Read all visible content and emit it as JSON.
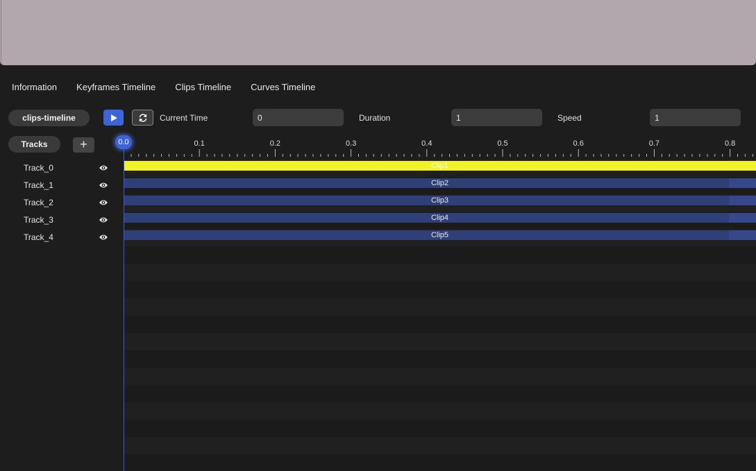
{
  "tabs": [
    "Information",
    "Keyframes Timeline",
    "Clips Timeline",
    "Curves Timeline"
  ],
  "controls": {
    "timeline_name": "clips-timeline",
    "current_time_label": "Current Time",
    "current_time_value": "0",
    "duration_label": "Duration",
    "duration_value": "1",
    "speed_label": "Speed",
    "speed_value": "1"
  },
  "tracks_header": {
    "label": "Tracks",
    "add_label": "+"
  },
  "tracks": [
    {
      "name": "Track_0",
      "clip": "Clip1",
      "selected": true
    },
    {
      "name": "Track_1",
      "clip": "Clip2",
      "selected": false
    },
    {
      "name": "Track_2",
      "clip": "Clip3",
      "selected": false
    },
    {
      "name": "Track_3",
      "clip": "Clip4",
      "selected": false
    },
    {
      "name": "Track_4",
      "clip": "Clip5",
      "selected": false
    }
  ],
  "ruler": {
    "ticks": [
      "0.1",
      "0.2",
      "0.3",
      "0.4",
      "0.5",
      "0.6",
      "0.7",
      "0.8"
    ],
    "playhead_label": "0.0"
  },
  "colors": {
    "accent": "#3e63d8",
    "selected_clip": "#f2f22a",
    "clip": "#2f3f78",
    "clip_overflow": "#36478a",
    "viewport": "#b3a7ae"
  }
}
